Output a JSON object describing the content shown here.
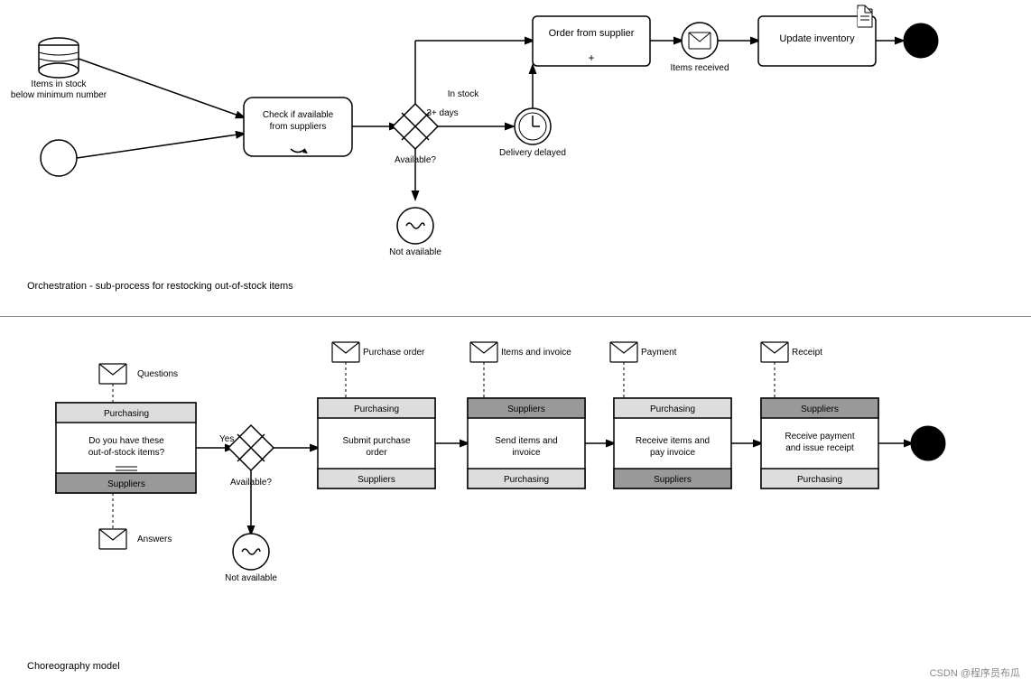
{
  "top_diagram": {
    "title": "Orchestration - sub-process for restocking out-of-stock items",
    "nodes": {
      "start1_label": "Items in stock\nbelow minimum number",
      "start2_label": "",
      "task1_label": "Check if available\nfrom suppliers",
      "gateway1_label": "Available?",
      "in_stock_label": "In stock",
      "order_label": "Order from supplier",
      "items_received_label": "Items received",
      "update_label": "Update inventory",
      "delivery_delayed_label": "Delivery delayed",
      "not_available_label": "Not available"
    }
  },
  "bottom_diagram": {
    "title": "Choreography model",
    "nodes": {
      "questions_label": "Questions",
      "answers_label": "Answers",
      "task_check_top": "Purchasing",
      "task_check_main": "Do you have these\nout-of-stock items?",
      "task_check_bot": "Suppliers",
      "gateway_label": "Available?",
      "yes_label": "Yes",
      "not_available_label": "Not available",
      "po_msg_label": "Purchase order",
      "task_po_top": "Purchasing",
      "task_po_main": "Submit purchase\norder",
      "task_po_bot": "Suppliers",
      "inv_msg_label": "Items and invoice",
      "task_inv_top": "Suppliers",
      "task_inv_main": "Send items and\ninvoice",
      "task_inv_bot": "Purchasing",
      "pay_msg_label": "Payment",
      "task_pay_top": "Purchasing",
      "task_pay_main": "Receive items and\npay invoice",
      "task_pay_bot": "Suppliers",
      "rec_msg_label": "Receipt",
      "task_rec_top": "Suppliers",
      "task_rec_main": "Receive payment\nand issue receipt",
      "task_rec_bot": "Purchasing"
    }
  },
  "watermark": "CSDN @程序员布瓜"
}
